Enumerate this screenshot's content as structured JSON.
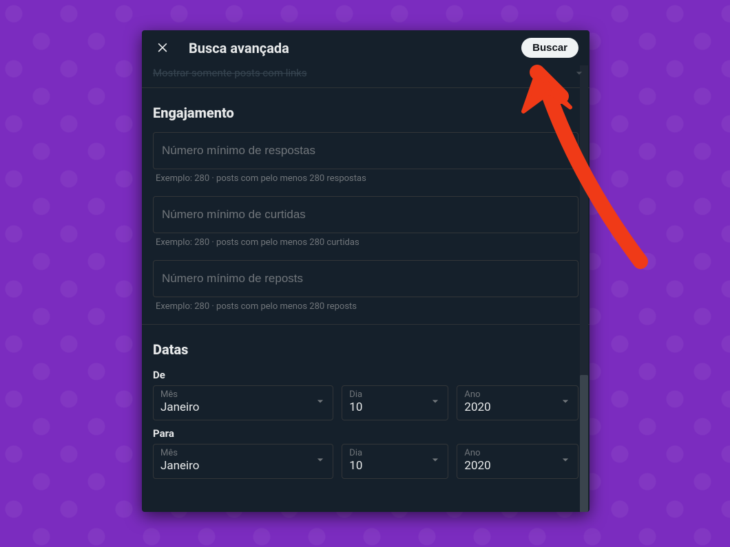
{
  "header": {
    "title": "Busca avançada",
    "search_label": "Buscar"
  },
  "truncated_option": "Mostrar somente posts com links",
  "engagement": {
    "title": "Engajamento",
    "min_replies_placeholder": "Número mínimo de respostas",
    "min_replies_hint": "Exemplo: 280 · posts com pelo menos 280 respostas",
    "min_likes_placeholder": "Número mínimo de curtidas",
    "min_likes_hint": "Exemplo: 280 · posts com pelo menos 280 curtidas",
    "min_reposts_placeholder": "Número mínimo de reposts",
    "min_reposts_hint": "Exemplo: 280 · posts com pelo menos 280 reposts"
  },
  "dates": {
    "title": "Datas",
    "from_label": "De",
    "to_label": "Para",
    "labels": {
      "month": "Mês",
      "day": "Dia",
      "year": "Ano"
    },
    "from": {
      "month": "Janeiro",
      "day": "10",
      "year": "2020"
    },
    "to": {
      "month": "Janeiro",
      "day": "10",
      "year": "2020"
    }
  },
  "annotation": {
    "color": "#f03a17"
  }
}
